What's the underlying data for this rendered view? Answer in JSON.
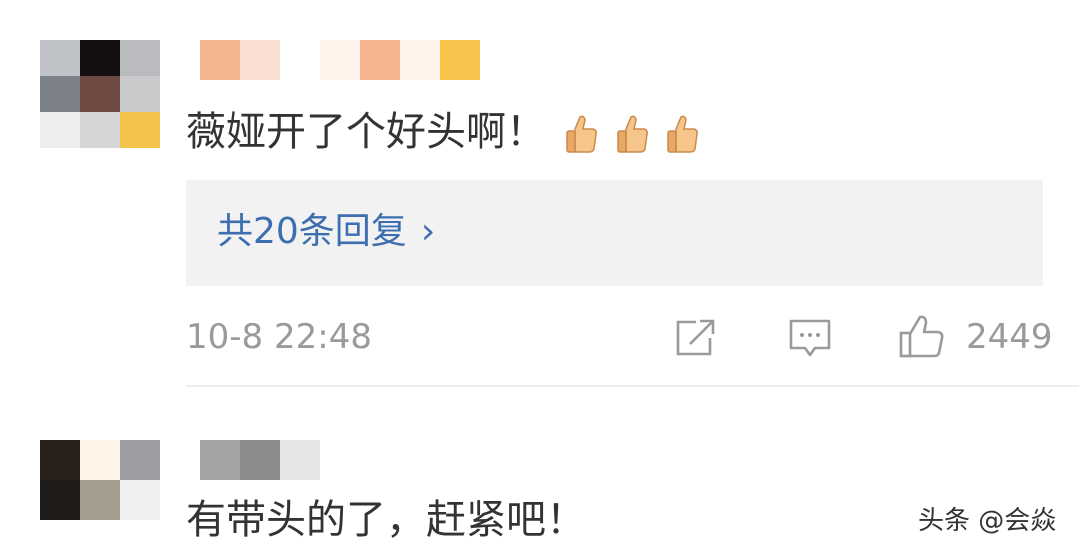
{
  "comments": [
    {
      "text": "薇娅开了个好头啊！",
      "emoji": "thumbs-up-emoji",
      "emoji_count": 3,
      "replies_label": "共20条回复",
      "timestamp": "10-8 22:48",
      "like_count": "2449"
    },
    {
      "text": "有带头的了，赶紧吧！"
    }
  ],
  "watermark": "头条 @会焱",
  "colors": {
    "link": "#3d6fb0",
    "meta_text": "#9a9a9a",
    "reply_box_bg": "#f2f2f2"
  }
}
